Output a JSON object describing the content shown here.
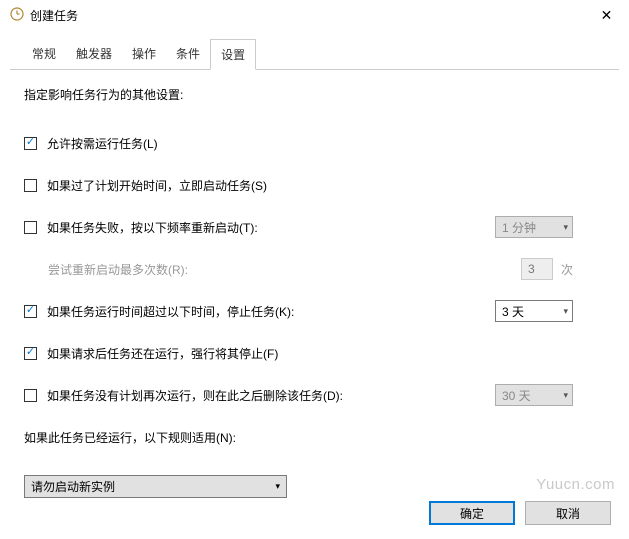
{
  "titlebar": {
    "title": "创建任务"
  },
  "tabs": {
    "items": [
      "常规",
      "触发器",
      "操作",
      "条件",
      "设置"
    ],
    "activeIndex": 4
  },
  "content": {
    "description": "指定影响任务行为的其他设置:",
    "allowOnDemand": {
      "label": "允许按需运行任务(L)",
      "checked": true
    },
    "runAsap": {
      "label": "如果过了计划开始时间，立即启动任务(S)",
      "checked": false
    },
    "restartOnFail": {
      "label": "如果任务失败，按以下频率重新启动(T):",
      "checked": false,
      "interval": "1 分钟"
    },
    "retryCount": {
      "label": "尝试重新启动最多次数(R):",
      "value": "3",
      "suffix": "次"
    },
    "stopIfLong": {
      "label": "如果任务运行时间超过以下时间，停止任务(K):",
      "checked": true,
      "duration": "3 天"
    },
    "forceStop": {
      "label": "如果请求后任务还在运行，强行将其停止(F)",
      "checked": true
    },
    "deleteIfNotScheduled": {
      "label": "如果任务没有计划再次运行，则在此之后删除该任务(D):",
      "checked": false,
      "duration": "30 天"
    },
    "ifRunning": {
      "label": "如果此任务已经运行，以下规则适用(N):"
    },
    "rule": {
      "value": "请勿启动新实例"
    }
  },
  "buttons": {
    "ok": "确定",
    "cancel": "取消"
  },
  "watermark": "Yuucn.com"
}
